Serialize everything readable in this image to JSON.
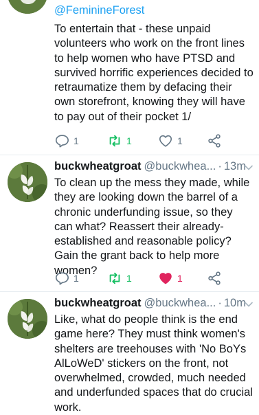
{
  "tweet1": {
    "mention": "@FeminineForest",
    "text": "To entertain that - these unpaid volunteers who work on the front lines to help women who have PTSD and survived horrific experiences decided to retraumatize them by defacing their own storefront, knowing they will have to pay out of their pocket 1/",
    "replies": "1",
    "retweets": "1",
    "likes": "1",
    "liked": false
  },
  "tweet2": {
    "name": "buckwheatgroat",
    "handle": "@buckwhea...",
    "dot": "·",
    "time": "13m",
    "text": "To clean up the mess they made, while they are looking down the barrel of a chronic underfunding issue, so they can what? Reassert their already-established and reasonable policy? Gain the grant back to help more women?",
    "replies": "1",
    "retweets": "1",
    "likes": "1",
    "liked": true
  },
  "tweet3": {
    "name": "buckwheatgroat",
    "handle": "@buckwhea...",
    "dot": "·",
    "time": "10m",
    "text": "Like, what do people think is the end game here? They must think women's shelters are treehouses with 'No BoYs AlLoWeD' stickers on the front, not overwhelmed, crowded, much needed and underfunded spaces that do crucial work."
  },
  "colors": {
    "link": "#1da1f2",
    "retweet": "#17bf63",
    "like": "#e0245e",
    "muted": "#657786"
  }
}
